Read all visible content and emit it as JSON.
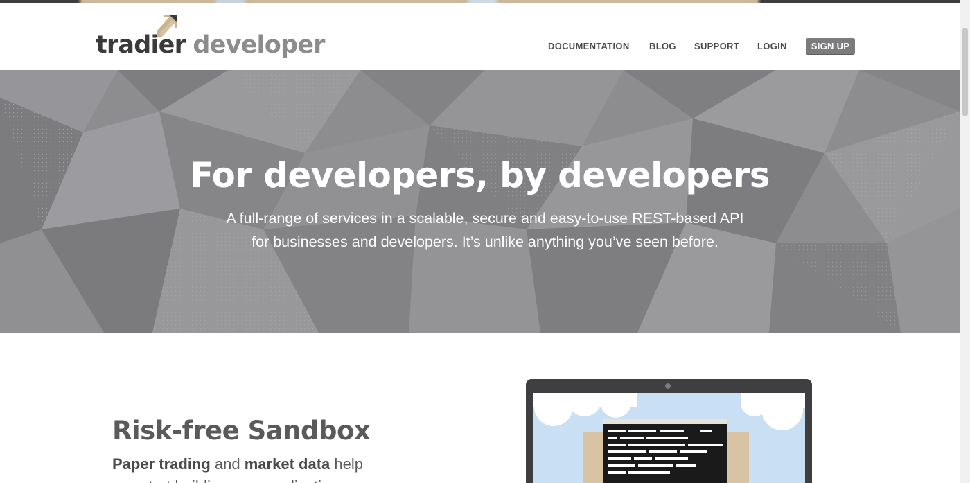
{
  "header": {
    "logo": {
      "brand": "tradier",
      "product": "developer"
    },
    "nav": [
      {
        "label": "DOCUMENTATION",
        "name": "nav-documentation"
      },
      {
        "label": "BLOG",
        "name": "nav-blog"
      },
      {
        "label": "SUPPORT",
        "name": "nav-support"
      },
      {
        "label": "LOGIN",
        "name": "nav-login"
      }
    ],
    "signup_label": "SIGN UP"
  },
  "hero": {
    "title": "For developers, by developers",
    "subtitle_line1": "A full-range of services in a scalable, secure and easy-to-use REST-based API",
    "subtitle_line2": "for businesses and developers. It’s unlike anything you’ve seen before."
  },
  "sandbox": {
    "title": "Risk-free Sandbox",
    "line1_bold1": "Paper trading",
    "line1_mid": " and ",
    "line1_bold2": "market data",
    "line1_end": " help",
    "line2": "you start building your applications"
  },
  "colors": {
    "brand_dark": "#3a3a3c",
    "brand_light": "#8c8c8e",
    "accent_gold": "#c9b48f",
    "hero_gray": "#8c8c8f",
    "signup_bg": "#7c7c7e"
  },
  "icons": {
    "logo_mark": "arrow-up-right-icon"
  }
}
